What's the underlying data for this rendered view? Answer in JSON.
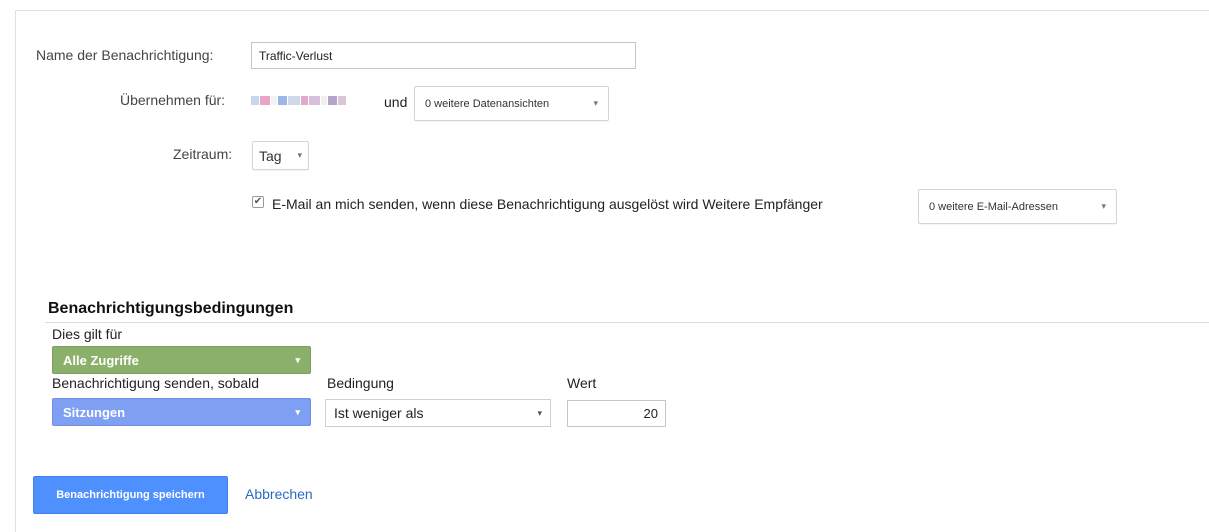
{
  "form": {
    "name_label": "Name der Benachrichtigung:",
    "name_value": "Traffic-Verlust",
    "apply_label": "Übernehmen für:",
    "apply_and": "und",
    "views_dropdown": "0 weitere Datenansichten",
    "period_label": "Zeitraum:",
    "period_value": "Tag",
    "email_checked": true,
    "email_text": "E-Mail an mich senden, wenn diese Benachrichtigung ausgelöst wird Weitere Empfänger",
    "email_dropdown": "0 weitere E-Mail-Adressen"
  },
  "conditions": {
    "heading": "Benachrichtigungsbedingungen",
    "applies_label": "Dies gilt für",
    "segment": "Alle Zugriffe",
    "send_label": "Benachrichtigung senden, sobald",
    "metric": "Sitzungen",
    "condition_label": "Bedingung",
    "condition_value": "Ist weniger als",
    "value_label": "Wert",
    "value": "20"
  },
  "actions": {
    "save": "Benachrichtigung speichern",
    "cancel": "Abbrechen"
  },
  "colors": {
    "segment_green": "#8bb06a",
    "metric_blue": "#7f9ff2",
    "primary_blue": "#4d90fe",
    "link_blue": "#2a6bbf"
  },
  "icons": {
    "caret": "▾",
    "check": "✔"
  }
}
